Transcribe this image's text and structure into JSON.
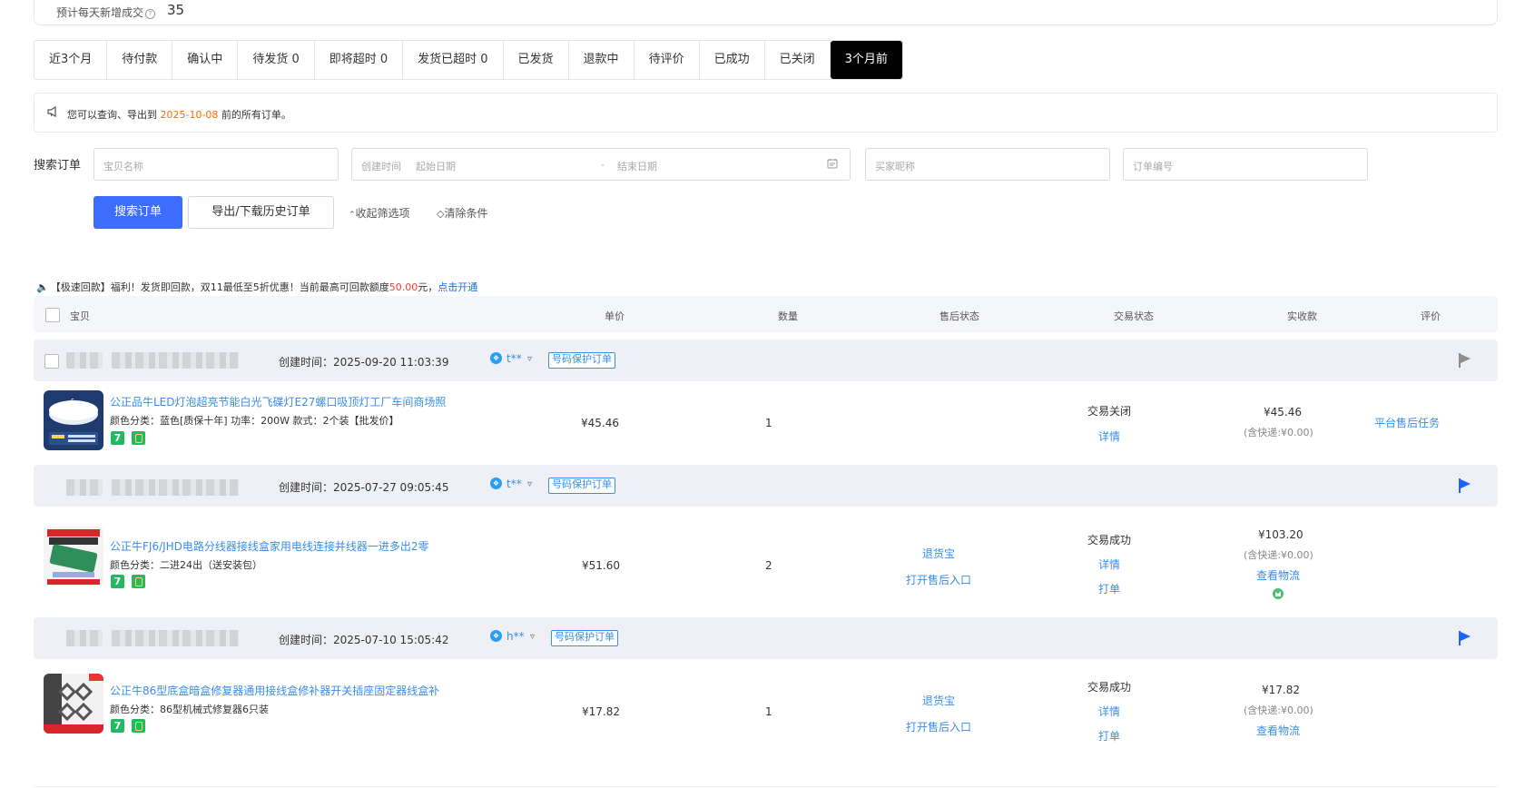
{
  "summary": {
    "label": "预计每天新增成交",
    "value": "35"
  },
  "tabs": [
    {
      "label": "近3个月",
      "active": false
    },
    {
      "label": "待付款",
      "active": false
    },
    {
      "label": "确认中",
      "active": false
    },
    {
      "label": "待发货 0",
      "active": false
    },
    {
      "label": "即将超时 0",
      "active": false
    },
    {
      "label": "发货已超时 0",
      "active": false
    },
    {
      "label": "已发货",
      "active": false
    },
    {
      "label": "退款中",
      "active": false
    },
    {
      "label": "待评价",
      "active": false
    },
    {
      "label": "已成功",
      "active": false
    },
    {
      "label": "已关闭",
      "active": false
    },
    {
      "label": "3个月前",
      "active": true
    }
  ],
  "notice": {
    "prefix": "您可以查询、导出到 ",
    "date": "2025-10-08",
    "suffix": " 前的所有订单。"
  },
  "search": {
    "label": "搜索订单",
    "item_placeholder": "宝贝名称",
    "time_label": "创建时间",
    "start_placeholder": "起始日期",
    "dash": "-",
    "end_placeholder": "结束日期",
    "buyer_placeholder": "买家昵称",
    "order_placeholder": "订单编号",
    "search_button": "搜索订单",
    "export_button": "导出/下载历史订单",
    "collapse_link": "收起筛选项",
    "clear_link": "清除条件"
  },
  "promo": {
    "p1": "【极速回款】福利！发货即回款，双11最低至5折优惠！当前最高可回款额度",
    "amount": "50.00",
    "p2": "元，",
    "link": "点击开通"
  },
  "table_header": {
    "item": "宝贝",
    "price": "单价",
    "qty": "数量",
    "after_sale": "售后状态",
    "trade": "交易状态",
    "paid": "实收款",
    "review": "评价"
  },
  "colors": {
    "accent": "#3d6dfd",
    "link": "#3a8ee6",
    "orange": "#ff6a00",
    "flag_blue": "#1a66ff",
    "flag_grey": "#8c8c8c"
  },
  "orders": [
    {
      "created": "创建时间：2025-09-20 11:03:39",
      "buyer": "t**",
      "protect_tag": "号码保护订单",
      "flag": "grey",
      "title": "公正品牛LED灯泡超亮节能白光飞碟灯E27螺口吸顶灯工厂车间商场照",
      "attrs": "颜色分类：蓝色[质保十年]  功率：200W  款式：2个装【批发价】",
      "price": "¥45.46",
      "qty": "1",
      "after_sale": [],
      "trade_status": "交易关闭",
      "trade_links": [
        "详情"
      ],
      "paid": "¥45.46",
      "shipping": "(含快递:¥0.00)",
      "paid_links": [],
      "review": "平台售后任务"
    },
    {
      "created": "创建时间：2025-07-27 09:05:45",
      "buyer": "t**",
      "protect_tag": "号码保护订单",
      "flag": "blue",
      "title": "公正牛FJ6/JHD电路分线器接线盒家用电线连接并线器一进多出2零",
      "attrs": "颜色分类：二进24出（送安装包）",
      "price": "¥51.60",
      "qty": "2",
      "after_sale": [
        "退货宝",
        "打开售后入口"
      ],
      "trade_status": "交易成功",
      "trade_links": [
        "详情",
        "打单"
      ],
      "paid": "¥103.20",
      "shipping": "(含快递:¥0.00)",
      "paid_links": [
        "查看物流"
      ],
      "review": ""
    },
    {
      "created": "创建时间：2025-07-10 15:05:42",
      "buyer": "h**",
      "protect_tag": "号码保护订单",
      "flag": "blue",
      "title": "公正牛86型底盒暗盒修复器通用接线盒修补器开关插座固定器线盒补",
      "attrs": "颜色分类：86型机械式修复器6只装",
      "price": "¥17.82",
      "qty": "1",
      "after_sale": [
        "退货宝",
        "打开售后入口"
      ],
      "trade_status": "交易成功",
      "trade_links": [
        "详情",
        "打单"
      ],
      "paid": "¥17.82",
      "shipping": "(含快递:¥0.00)",
      "paid_links": [
        "查看物流"
      ],
      "review": ""
    }
  ]
}
